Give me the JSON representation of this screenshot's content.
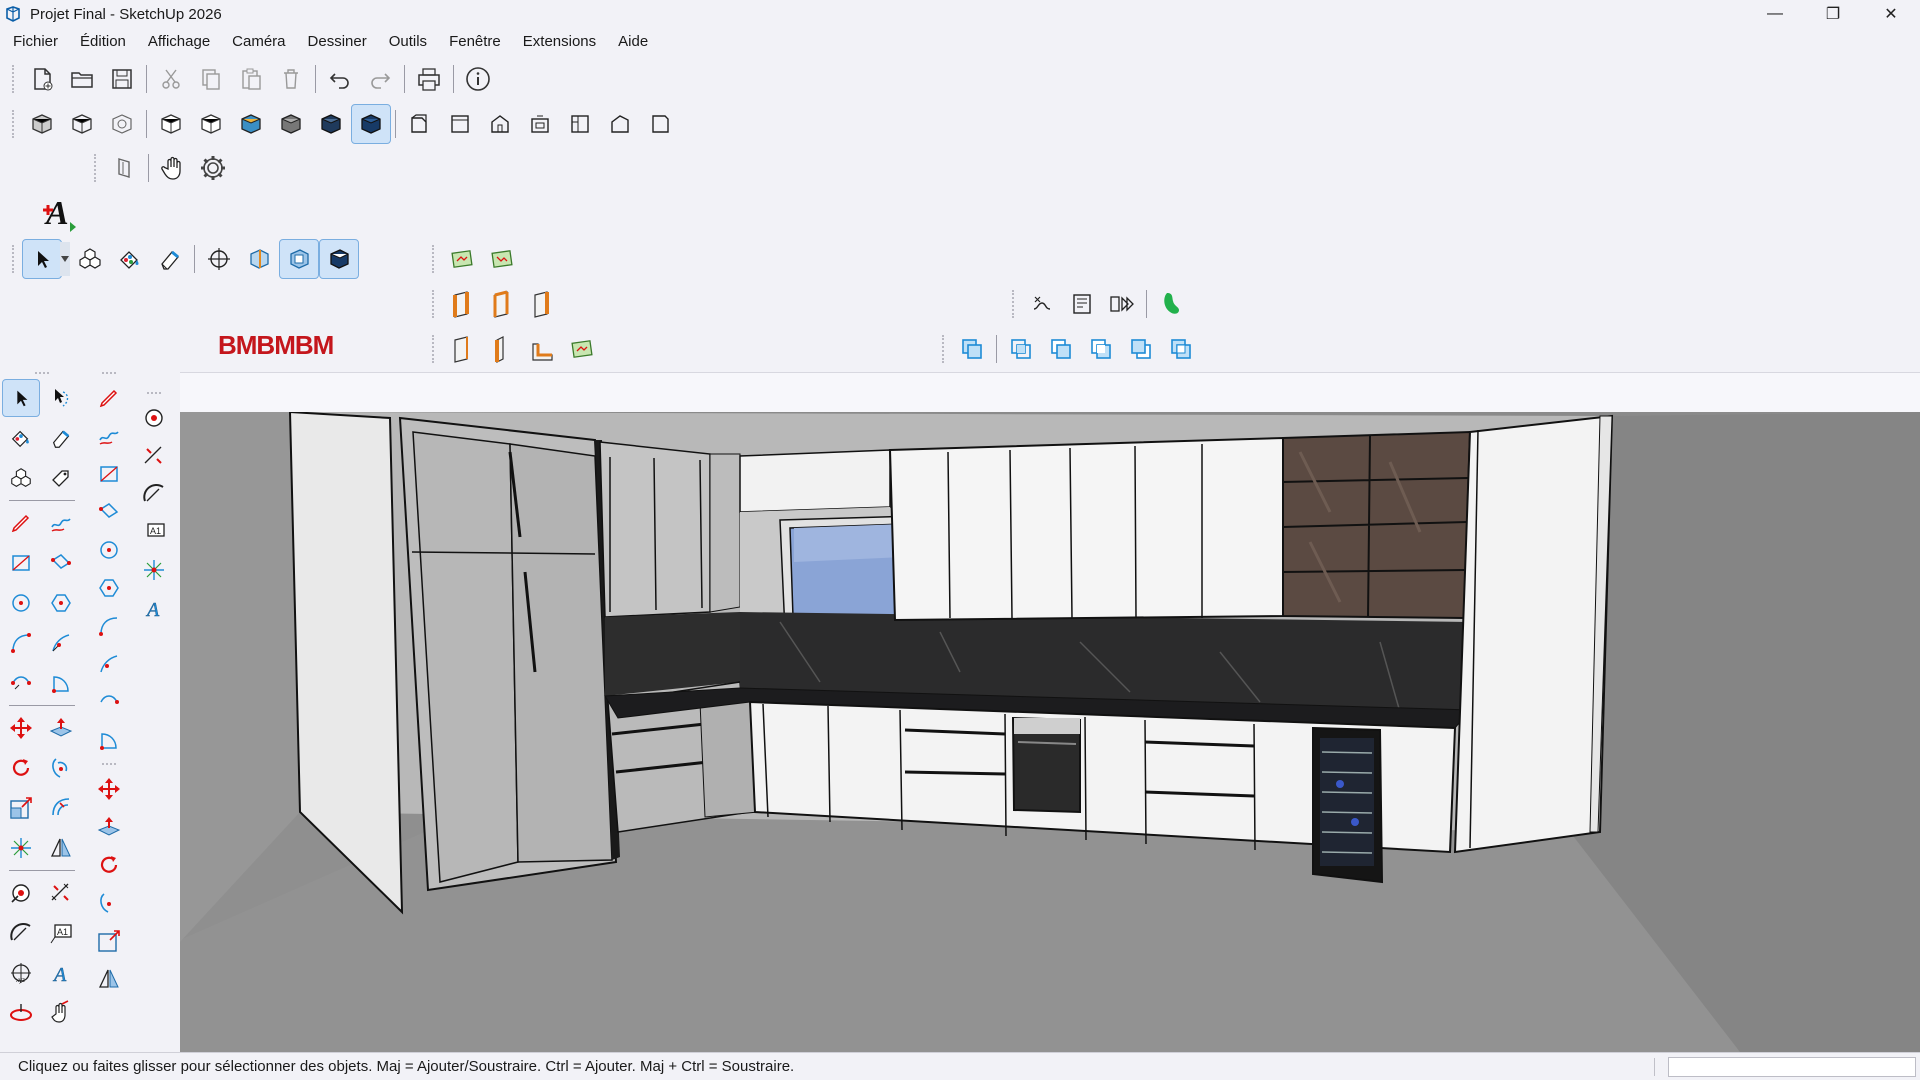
{
  "window": {
    "title": "Projet Final - SketchUp 2026",
    "controls": {
      "minimize": "—",
      "maximize": "❐",
      "close": "✕"
    }
  },
  "menu": {
    "items": [
      "Fichier",
      "Édition",
      "Affichage",
      "Caméra",
      "Dessiner",
      "Outils",
      "Fenêtre",
      "Extensions",
      "Aide"
    ]
  },
  "logos": {
    "bm": "BMBMBM"
  },
  "status": {
    "hint": "Cliquez ou faites glisser pour sélectionner des objets. Maj = Ajouter/Soustraire. Ctrl = Ajouter. Maj + Ctrl = Soustraire.",
    "measurements": ""
  },
  "colors": {
    "accent": "#1e8bd6",
    "active_tool_bg": "#cfe3f8",
    "sky_window": "#8aa4d6",
    "wood": "#5b4a42",
    "countertop": "#1c1c1e"
  }
}
